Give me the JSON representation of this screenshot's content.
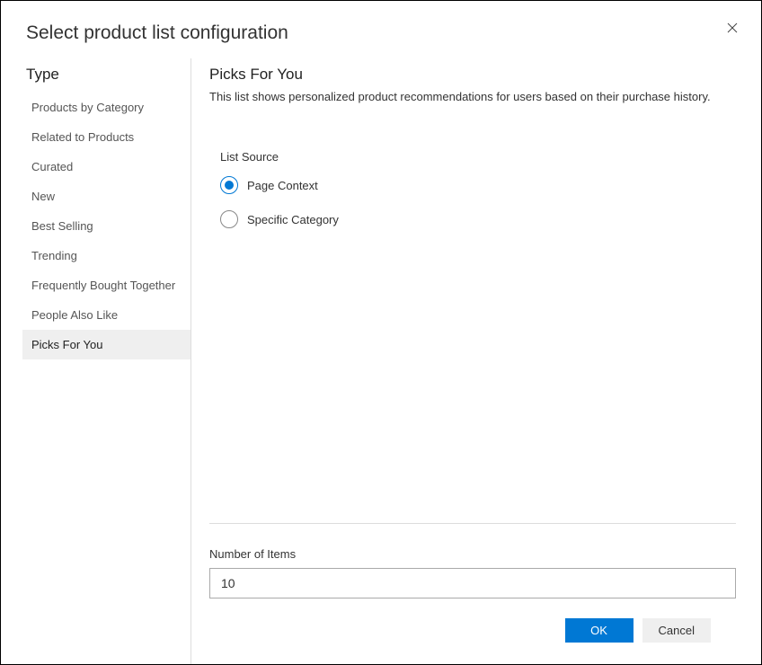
{
  "dialog": {
    "title": "Select product list configuration"
  },
  "sidebar": {
    "title": "Type",
    "items": [
      {
        "label": "Products by Category",
        "selected": false
      },
      {
        "label": "Related to Products",
        "selected": false
      },
      {
        "label": "Curated",
        "selected": false
      },
      {
        "label": "New",
        "selected": false
      },
      {
        "label": "Best Selling",
        "selected": false
      },
      {
        "label": "Trending",
        "selected": false
      },
      {
        "label": "Frequently Bought Together",
        "selected": false
      },
      {
        "label": "People Also Like",
        "selected": false
      },
      {
        "label": "Picks For You",
        "selected": true
      }
    ]
  },
  "main": {
    "title": "Picks For You",
    "description": "This list shows personalized product recommendations for users based on their purchase history.",
    "listSource": {
      "label": "List Source",
      "options": [
        {
          "label": "Page Context",
          "checked": true
        },
        {
          "label": "Specific Category",
          "checked": false
        }
      ]
    },
    "numberOfItems": {
      "label": "Number of Items",
      "value": "10"
    }
  },
  "footer": {
    "ok": "OK",
    "cancel": "Cancel"
  }
}
